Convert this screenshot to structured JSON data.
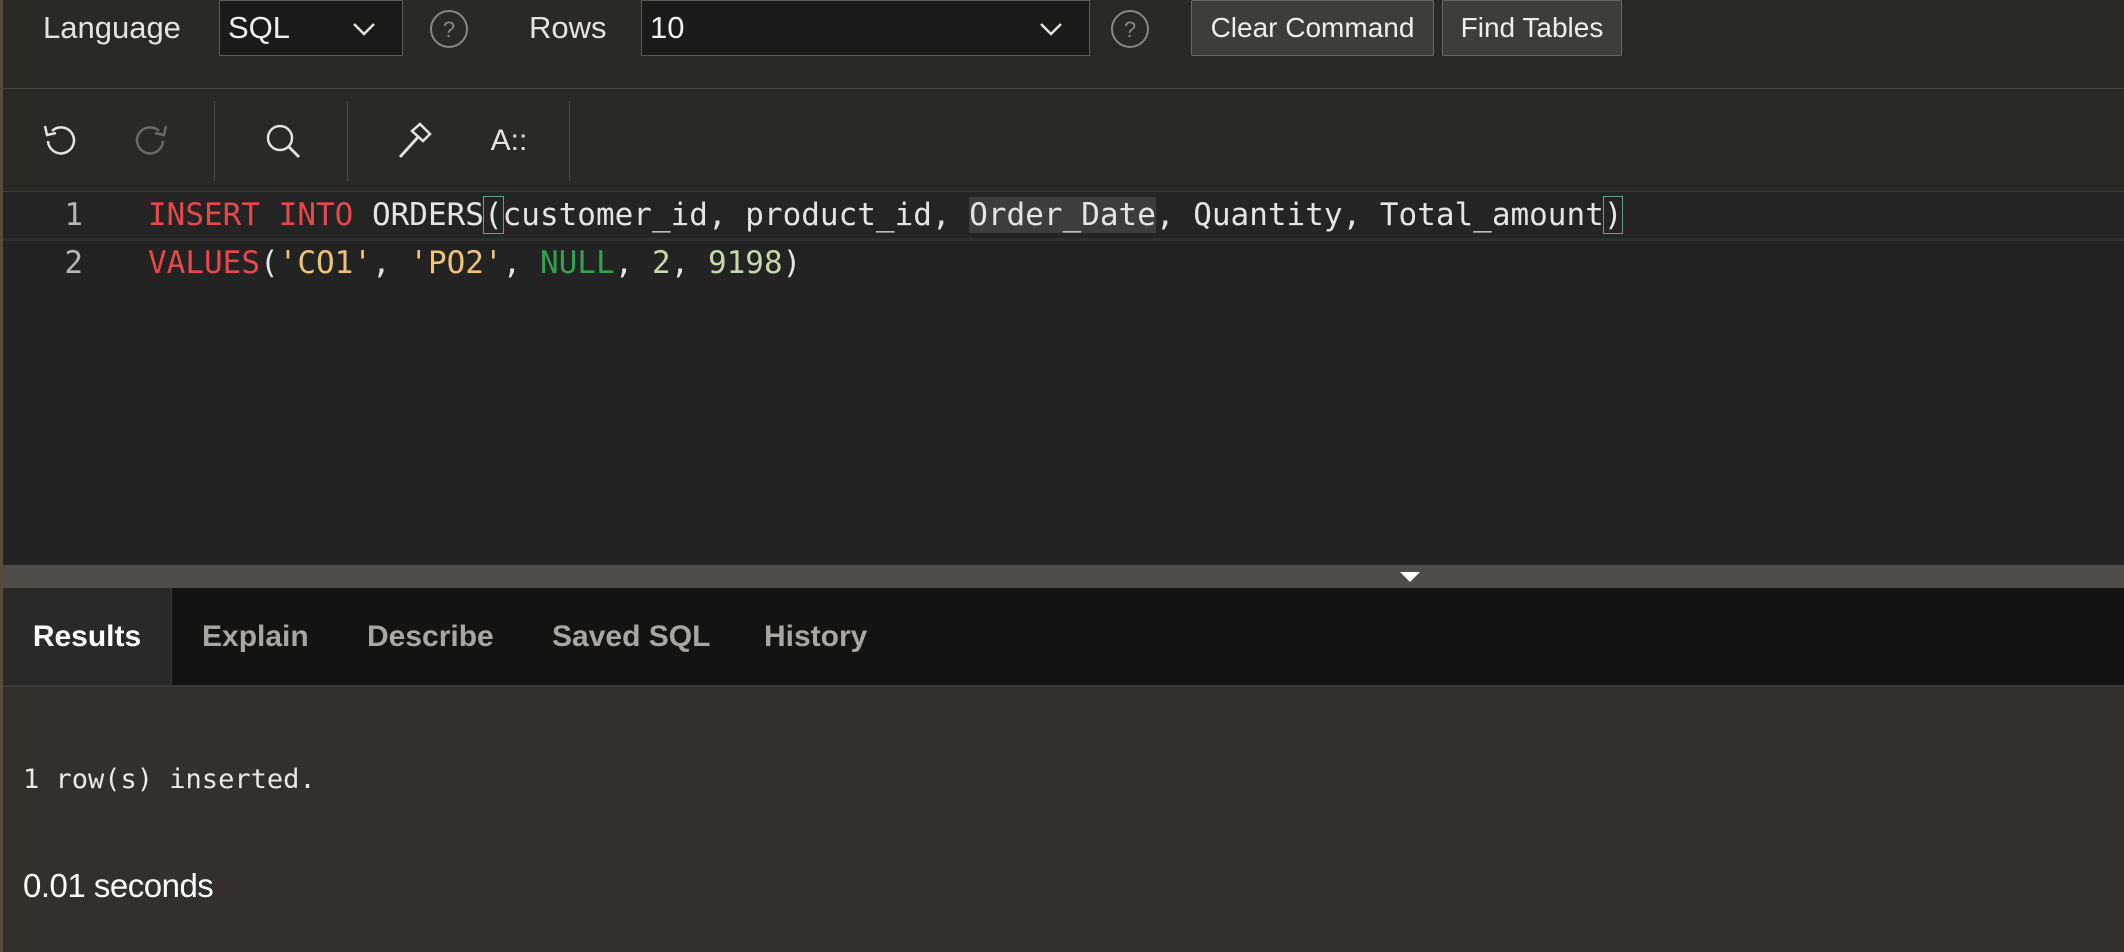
{
  "toolbar_top": {
    "language_label": "Language",
    "language_value": "SQL",
    "rows_label": "Rows",
    "rows_value": "10",
    "clear_command": "Clear Command",
    "find_tables": "Find Tables"
  },
  "editor_toolbar": {
    "icons": [
      "undo-icon",
      "redo-icon",
      "search-icon",
      "hammer-icon",
      "text-format-icon"
    ],
    "format_label": "A::"
  },
  "editor": {
    "lines": [
      {
        "number": "1"
      },
      {
        "number": "2"
      }
    ],
    "line1_tokens": [
      "INSERT",
      " ",
      "INTO",
      " ORDERS",
      "(",
      "customer_id, product_id, ",
      "Order_Date",
      ", Quantity, Total_amount",
      ")"
    ],
    "line2_tokens": [
      "VALUES",
      "(",
      "'CO1'",
      ", ",
      "'PO2'",
      ", ",
      "NULL",
      ", ",
      "2",
      ", ",
      "9198",
      ")"
    ]
  },
  "tabs": [
    {
      "label": "Results",
      "active": true
    },
    {
      "label": "Explain"
    },
    {
      "label": "Describe"
    },
    {
      "label": "Saved SQL"
    },
    {
      "label": "History"
    }
  ],
  "results": {
    "message": "1 row(s) inserted.",
    "elapsed": "0.01 seconds"
  },
  "colors": {
    "keyword": "#e8484a",
    "string": "#f0c27a",
    "null": "#2fa44f",
    "number": "#c3d9a8"
  }
}
